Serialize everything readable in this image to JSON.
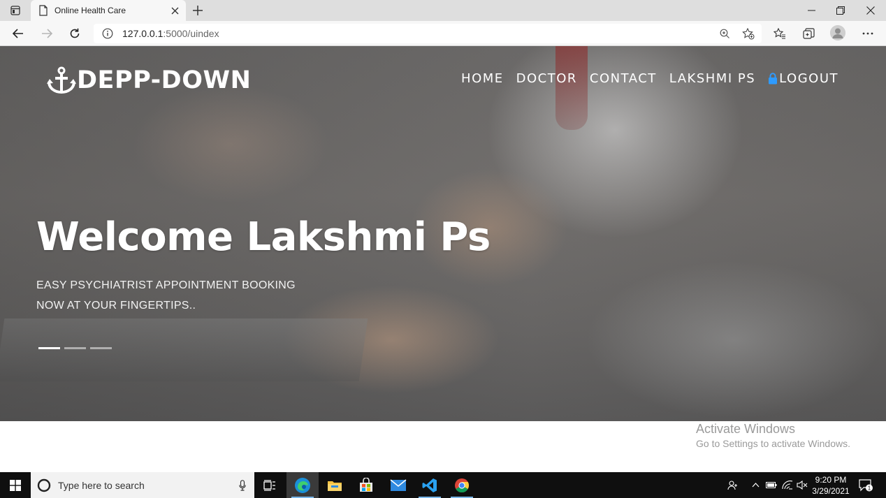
{
  "browser": {
    "tab_title": "Online Health Care",
    "url_host": "127.0.0.1",
    "url_rest": ":5000/uindex"
  },
  "site": {
    "brand": "DEPP-DOWN",
    "menu": {
      "home": "HOME",
      "doctor": "DOCTOR",
      "contact": "CONTACT",
      "user": "LAKSHMI PS",
      "logout": "LOGOUT"
    },
    "hero": {
      "title": "Welcome Lakshmi Ps",
      "subtitle_line1": "EASY PSYCHIATRIST APPOINTMENT BOOKING",
      "subtitle_line2": "NOW AT YOUR FINGERTIPS..",
      "slide_count": 3,
      "active_slide": 1
    }
  },
  "watermark": {
    "line1": "Activate Windows",
    "line2": "Go to Settings to activate Windows."
  },
  "taskbar": {
    "search_placeholder": "Type here to search",
    "time": "9:20 PM",
    "date": "3/29/2021",
    "notification_count": "1"
  },
  "colors": {
    "accent_taskbar": "#7ab6e8",
    "lock_icon": "#2e9bff"
  }
}
